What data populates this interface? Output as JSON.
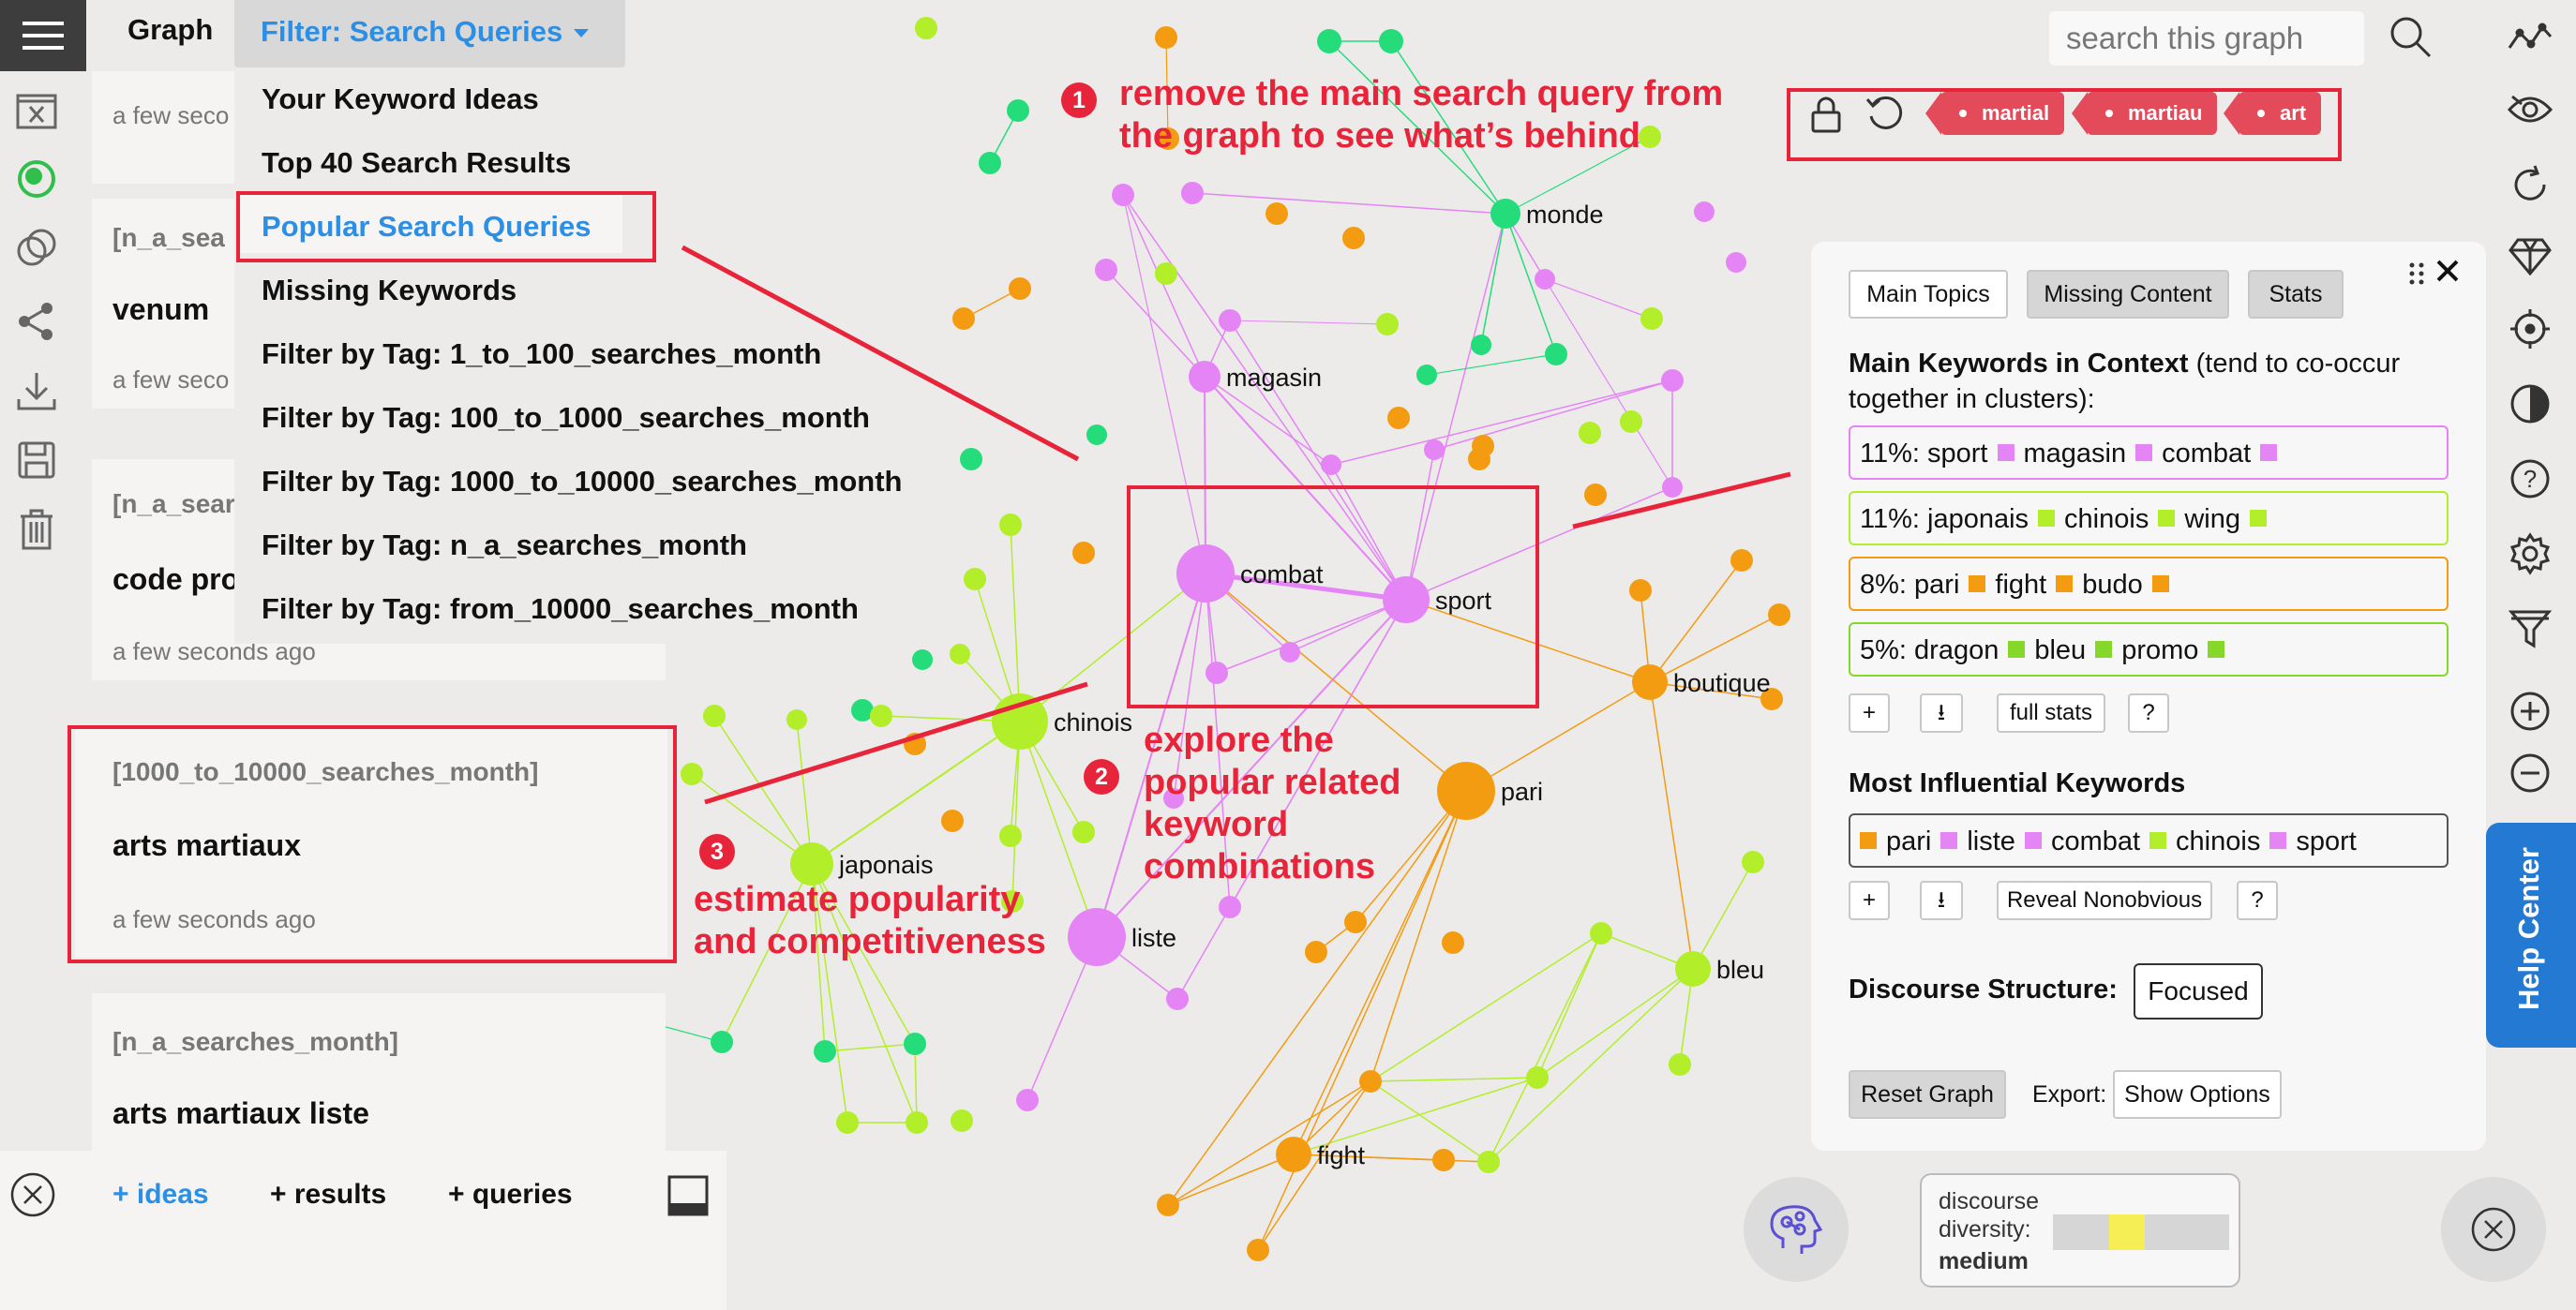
{
  "colors": {
    "pink": "#e584f5",
    "lime": "#b3ee2b",
    "orange": "#f39c12",
    "green": "#25dc7a",
    "annotation_red": "#e8243a",
    "link_blue": "#2b8fe6",
    "help_blue": "#2479d2"
  },
  "left_toolbar": {
    "icons": [
      "menu-icon",
      "close-file-icon",
      "layers-icon",
      "overlap-circles-icon",
      "share-icon",
      "download-icon",
      "save-icon",
      "trash-icon"
    ]
  },
  "header": {
    "title": "Graph",
    "filter_label": "Filter: Search Queries"
  },
  "dropdown": {
    "items": [
      "Your Keyword Ideas",
      "Top 40 Search Results",
      "Popular Search Queries",
      "Missing Keywords",
      "Filter by Tag: 1_to_100_searches_month",
      "Filter by Tag: 100_to_1000_searches_month",
      "Filter by Tag: 1000_to_10000_searches_month",
      "Filter by Tag: n_a_searches_month",
      "Filter by Tag: from_10000_searches_month"
    ],
    "active_index": 2
  },
  "cards": [
    {
      "tag": "",
      "title": "",
      "time": "a few seco"
    },
    {
      "tag": "[n_a_sea",
      "title": "venum",
      "time": "a few seco"
    },
    {
      "tag": "[n_a_sear",
      "title": "code pro",
      "time": "a few seconds ago"
    },
    {
      "tag": "[1000_to_10000_searches_month]",
      "title": "arts martiaux",
      "time": "a few seconds ago"
    },
    {
      "tag": "[n_a_searches_month]",
      "title": "arts martiaux liste",
      "time": ""
    }
  ],
  "bottom_bar": {
    "ideas": "+ ideas",
    "results": "+ results",
    "queries": "+ queries"
  },
  "annotations": {
    "a1_num": "1",
    "a1_line1": "remove the main search query from",
    "a1_line2": "the graph to see what’s behind",
    "a2_num": "2",
    "a2_line1": "explore the",
    "a2_line2": "popular related",
    "a2_line3": "keyword",
    "a2_line4": "combinations",
    "a3_num": "3",
    "a3_line1": "estimate popularity",
    "a3_line2": "and competitiveness"
  },
  "search": {
    "placeholder": "search this graph"
  },
  "top_tags": [
    "martial",
    "martiau",
    "art"
  ],
  "graph": {
    "labels": [
      "monde",
      "magasin",
      "combat",
      "sport",
      "chinois",
      "boutique",
      "pari",
      "japonais",
      "liste",
      "bleu",
      "fight"
    ]
  },
  "panel": {
    "tabs": {
      "main_topics": "Main Topics",
      "missing_content": "Missing Content",
      "stats": "Stats"
    },
    "main_keywords_heading": "Main Keywords in Context",
    "main_keywords_note": "(tend to co-occur",
    "main_keywords_note2": "together in clusters):",
    "clusters": [
      {
        "pct": "11%:",
        "words": [
          "sport",
          "magasin",
          "combat"
        ],
        "color": "#e584f5"
      },
      {
        "pct": "11%:",
        "words": [
          "japonais",
          "chinois",
          "wing"
        ],
        "color": "#b3ee2b"
      },
      {
        "pct": "8%:",
        "words": [
          "pari",
          "fight",
          "budo"
        ],
        "color": "#f39c12"
      },
      {
        "pct": "5%:",
        "words": [
          "dragon",
          "bleu",
          "promo"
        ],
        "color": "#85d82a"
      }
    ],
    "btn_plus": "+",
    "btn_down": "⭳",
    "btn_full_stats": "full stats",
    "btn_help": "?",
    "influential_heading": "Most Influential Keywords",
    "influential": [
      {
        "word": "pari",
        "color": "#f39c12"
      },
      {
        "word": "liste",
        "color": "#e584f5"
      },
      {
        "word": "combat",
        "color": "#e584f5"
      },
      {
        "word": "chinois",
        "color": "#b3ee2b"
      },
      {
        "word": "sport",
        "color": "#e584f5"
      }
    ],
    "btn_reveal": "Reveal Nonobvious",
    "discourse_label": "Discourse Structure:",
    "discourse_value": "Focused",
    "reset": "Reset Graph",
    "export_label": "Export:",
    "show_options": "Show Options"
  },
  "right_toolbar": {
    "icons": [
      "graph-line-icon",
      "eye-icon",
      "refresh-icon",
      "diamond-icon",
      "target-icon",
      "contrast-icon",
      "help-icon",
      "settings-icon",
      "filter-icon",
      "zoom-in-icon",
      "zoom-out-icon"
    ],
    "help_center": "Help Center"
  },
  "diversity": {
    "line1": "discourse",
    "line2": "diversity:",
    "value": "medium"
  }
}
